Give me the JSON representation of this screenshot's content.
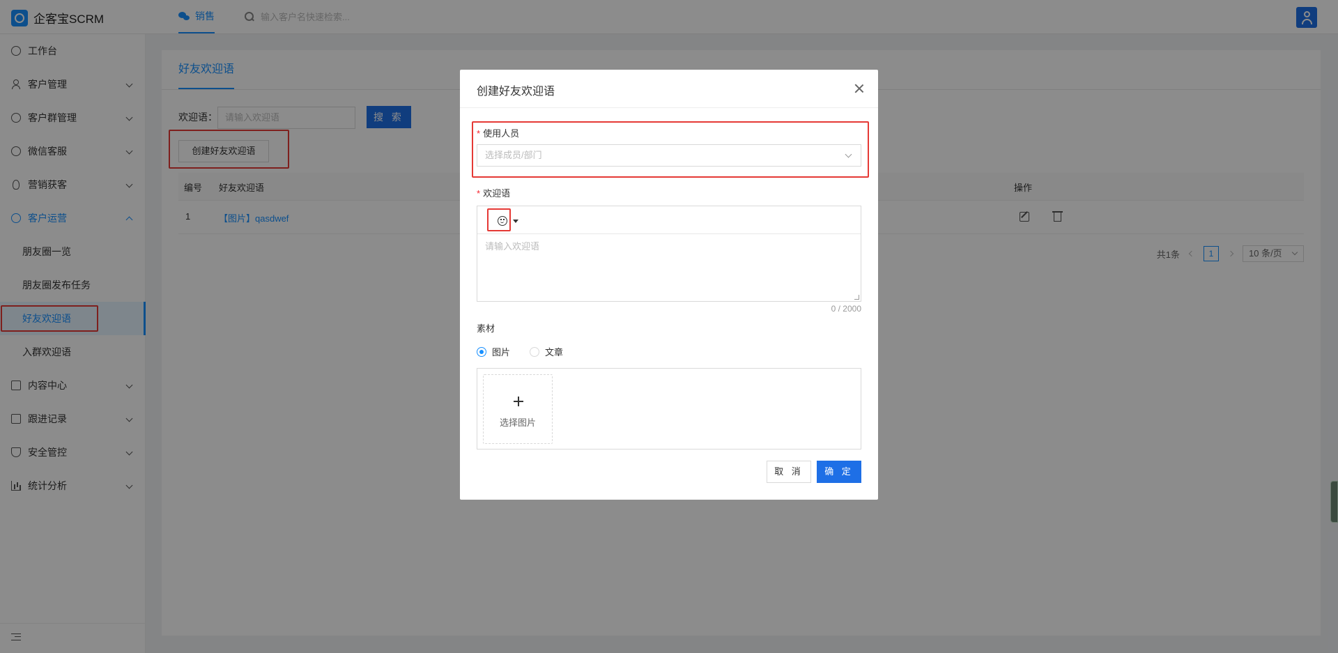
{
  "header": {
    "logo_text": "企客宝SCRM",
    "nav_tab": "销售",
    "search_placeholder": "输入客户名快速检索..."
  },
  "sidebar": {
    "items": [
      {
        "label": "工作台",
        "icon": "dashboard-icon"
      },
      {
        "label": "客户管理",
        "icon": "customer-icon"
      },
      {
        "label": "客户群管理",
        "icon": "group-chat-icon"
      },
      {
        "label": "微信客服",
        "icon": "wechat-service-icon"
      },
      {
        "label": "营销获客",
        "icon": "bulb-icon"
      },
      {
        "label": "客户运营",
        "icon": "operation-icon"
      },
      {
        "label": "内容中心",
        "icon": "content-icon"
      },
      {
        "label": "跟进记录",
        "icon": "record-icon"
      },
      {
        "label": "安全管控",
        "icon": "shield-icon"
      },
      {
        "label": "统计分析",
        "icon": "chart-icon"
      }
    ],
    "sub_items": [
      "朋友圈一览",
      "朋友圈发布任务",
      "好友欢迎语",
      "入群欢迎语"
    ]
  },
  "main": {
    "page_tab": "好友欢迎语",
    "filter_label": "欢迎语：",
    "filter_placeholder": "请输入欢迎语",
    "search_button": "搜 索",
    "create_button": "创建好友欢迎语",
    "table": {
      "headers": [
        "编号",
        "好友欢迎语",
        "操作"
      ],
      "rows": [
        {
          "id": "1",
          "content": "【图片】qasdwef"
        }
      ]
    },
    "pagination": {
      "total": "共1条",
      "current_page": "1",
      "page_size": "10 条/页"
    }
  },
  "modal": {
    "title": "创建好友欢迎语",
    "user_label": "使用人员",
    "user_placeholder": "选择成员/部门",
    "welcome_label": "欢迎语",
    "welcome_placeholder": "请输入欢迎语",
    "counter": "0 / 2000",
    "material_label": "素材",
    "radio_image": "图片",
    "radio_article": "文章",
    "upload_text": "选择图片",
    "cancel_button": "取 消",
    "ok_button": "确 定"
  }
}
